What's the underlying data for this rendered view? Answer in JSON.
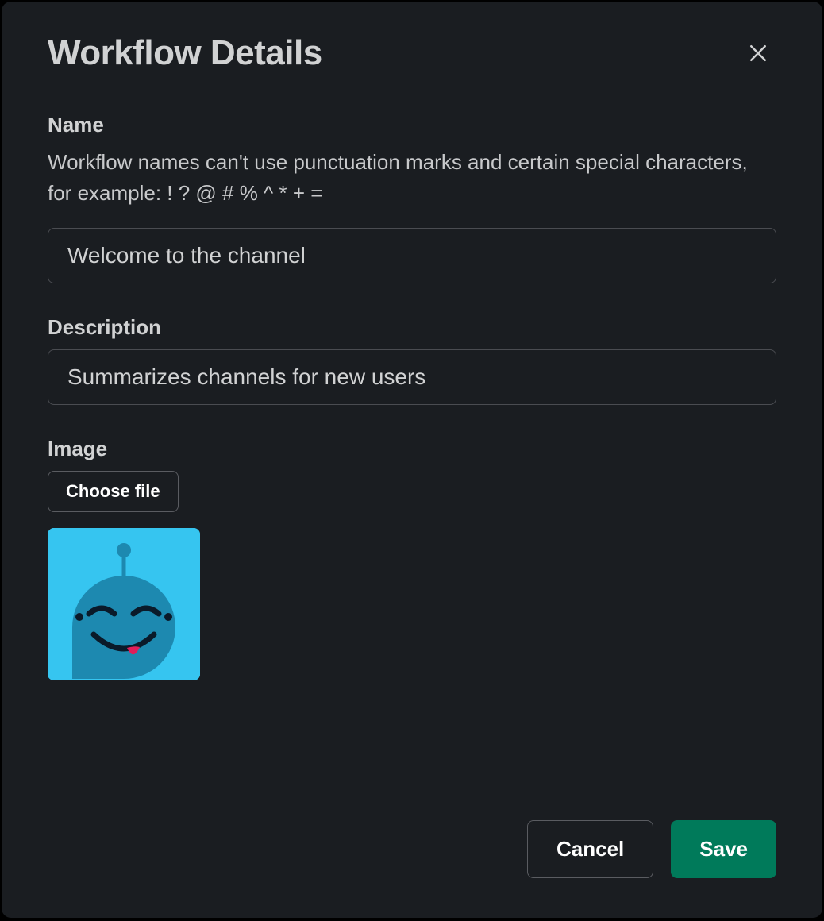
{
  "modal": {
    "title": "Workflow Details"
  },
  "name": {
    "label": "Name",
    "help": "Workflow names can't use punctuation marks and certain special characters, for example: ! ? @ # % ^ * + =",
    "value": "Welcome to the channel"
  },
  "description": {
    "label": "Description",
    "value": "Summarizes channels for new users"
  },
  "image": {
    "label": "Image",
    "choose_label": "Choose file"
  },
  "footer": {
    "cancel_label": "Cancel",
    "save_label": "Save"
  }
}
